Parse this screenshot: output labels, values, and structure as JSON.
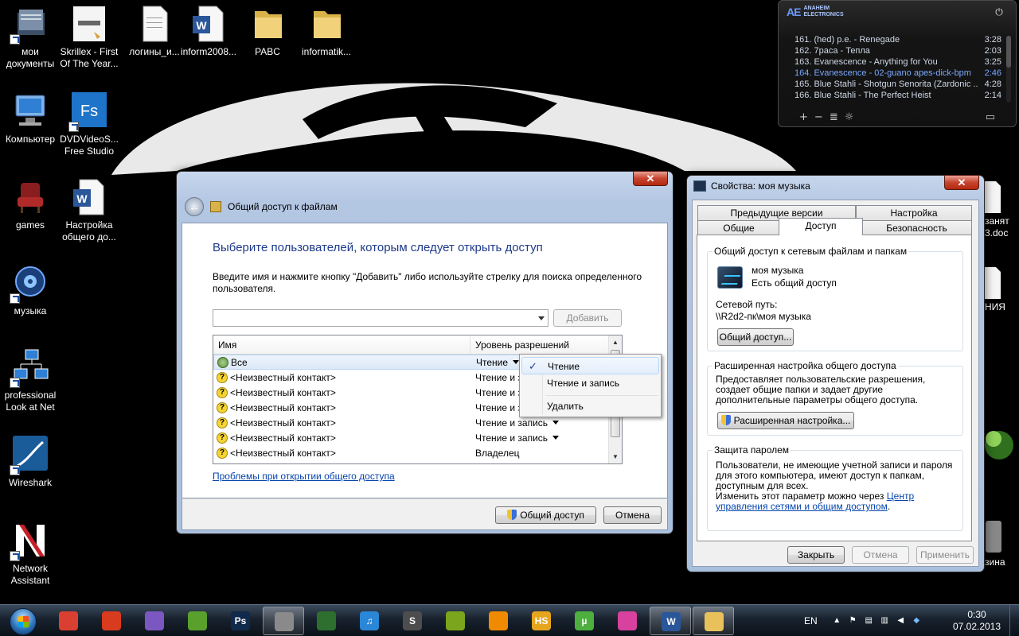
{
  "desktop": {
    "icons": [
      {
        "label": "мои документы",
        "icon": "documents-folder-icon"
      },
      {
        "label": "Skrillex - First Of The Year...",
        "icon": "image-file-icon"
      },
      {
        "label": "логины_и...",
        "icon": "text-file-icon"
      },
      {
        "label": "inform2008...",
        "icon": "word-doc-icon"
      },
      {
        "label": "PABC",
        "icon": "folder-icon"
      },
      {
        "label": "informatik...",
        "icon": "folder-icon"
      },
      {
        "label": "Компьютер",
        "icon": "computer-icon"
      },
      {
        "label": "DVDVideoS... Free Studio",
        "icon": "fs-app-icon"
      },
      {
        "label": "games",
        "icon": "armchair-icon"
      },
      {
        "label": "Настройка общего до...",
        "icon": "word-doc-icon"
      },
      {
        "label": "музыка",
        "icon": "music-icon"
      },
      {
        "label": "professional Look at Net",
        "icon": "network-icon"
      },
      {
        "label": "Wireshark",
        "icon": "wireshark-icon"
      },
      {
        "label": "Network Assistant",
        "icon": "network-assistant-icon"
      }
    ],
    "right_edge_labels": [
      "занят",
      "3.doc",
      "НИЯ",
      "зина"
    ]
  },
  "player": {
    "brand_line1": "ANAHEIM",
    "brand_line2": "ELECTRONICS",
    "brand_mark": "AE",
    "power_icon": "power-icon",
    "playlist": [
      {
        "title": "161. (hed) p.e. - Renegade",
        "duration": "3:28",
        "active": false
      },
      {
        "title": "162. 7раса - Тепла",
        "duration": "2:03",
        "active": false
      },
      {
        "title": "163. Evanescence - Anything for You",
        "duration": "3:25",
        "active": false
      },
      {
        "title": "164. Evanescence - 02-guano apes-dick-bpm",
        "duration": "2:46",
        "active": true
      },
      {
        "title": "165. Blue Stahli - Shotgun Senorita (Zardonic ...",
        "duration": "4:28",
        "active": false
      },
      {
        "title": "166. Blue Stahli - The Perfect Heist",
        "duration": "2:14",
        "active": false
      }
    ],
    "controls": [
      "+",
      "−",
      "≣",
      "☼"
    ]
  },
  "share_wizard": {
    "back_icon": "back-arrow-icon",
    "title": "Общий доступ к файлам",
    "heading": "Выберите пользователей, которым следует открыть доступ",
    "description": "Введите имя и нажмите кнопку \"Добавить\" либо используйте стрелку для поиска определенного пользователя.",
    "input_value": "",
    "add_button": "Добавить",
    "columns": [
      "Имя",
      "Уровень разрешений"
    ],
    "rows": [
      {
        "name": "Все",
        "permission": "Чтение",
        "icon": "users-group-icon",
        "selected": true,
        "dropdown": true
      },
      {
        "name": "<Неизвестный контакт>",
        "permission": "Чтение и запись",
        "icon": "unknown-contact-icon",
        "selected": false,
        "dropdown": true
      },
      {
        "name": "<Неизвестный контакт>",
        "permission": "Чтение и запись",
        "icon": "unknown-contact-icon",
        "selected": false,
        "dropdown": true
      },
      {
        "name": "<Неизвестный контакт>",
        "permission": "Чтение и запись",
        "icon": "unknown-contact-icon",
        "selected": false,
        "dropdown": true
      },
      {
        "name": "<Неизвестный контакт>",
        "permission": "Чтение и запись",
        "icon": "unknown-contact-icon",
        "selected": false,
        "dropdown": true
      },
      {
        "name": "<Неизвестный контакт>",
        "permission": "Чтение и запись",
        "icon": "unknown-contact-icon",
        "selected": false,
        "dropdown": true
      },
      {
        "name": "<Неизвестный контакт>",
        "permission": "Владелец",
        "icon": "unknown-contact-icon",
        "selected": false,
        "dropdown": false
      }
    ],
    "help_link": "Проблемы при открытии общего доступа",
    "share_button": "Общий доступ",
    "cancel_button": "Отмена"
  },
  "permission_menu": {
    "items": [
      "Чтение",
      "Чтение и запись",
      "Удалить"
    ],
    "checked": "Чтение",
    "check_mark": "✓"
  },
  "properties": {
    "title": "Свойства: моя музыка",
    "tabs_row1": [
      "Предыдущие версии",
      "Настройка"
    ],
    "tabs_row2": [
      "Общие",
      "Доступ",
      "Безопасность"
    ],
    "active_tab": "Доступ",
    "network_group": {
      "title": "Общий доступ к сетевым файлам и папкам",
      "folder_name": "моя музыка",
      "status": "Есть общий доступ",
      "path_label": "Сетевой путь:",
      "path": "\\\\R2d2-пк\\моя музыка",
      "button": "Общий доступ..."
    },
    "advanced_group": {
      "title": "Расширенная настройка общего доступа",
      "text": "Предоставляет пользовательские разрешения, создает общие папки и задает другие дополнительные параметры общего доступа.",
      "button": "Расширенная настройка..."
    },
    "password_group": {
      "title": "Защита паролем",
      "text": "Пользователи, не имеющие учетной записи и пароля для этого компьютера, имеют доступ к папкам, доступным для всех.",
      "change_prefix": "Изменить этот параметр можно через ",
      "change_link": "Центр управления сетями и общим доступом",
      "change_suffix": "."
    },
    "buttons": {
      "close": "Закрыть",
      "cancel": "Отмена",
      "apply": "Применить"
    }
  },
  "taskbar": {
    "apps": [
      {
        "name": "chrome-icon",
        "glyph": "",
        "color": "#d94032",
        "active": false
      },
      {
        "name": "lightning-app-icon",
        "glyph": "",
        "color": "#d83b1e",
        "active": false
      },
      {
        "name": "visual-studio-icon",
        "glyph": "",
        "color": "#7b57c1",
        "active": false
      },
      {
        "name": "geo-app-icon",
        "glyph": "",
        "color": "#5aa02c",
        "active": false
      },
      {
        "name": "photoshop-icon",
        "glyph": "Ps",
        "color": "#0f2a4a",
        "active": false
      },
      {
        "name": "aimp-icon",
        "glyph": "",
        "color": "#8a8a8a",
        "active": true
      },
      {
        "name": "cd-player-icon",
        "glyph": "",
        "color": "#2e6e2e",
        "active": false
      },
      {
        "name": "music-notes-icon",
        "glyph": "♫",
        "color": "#2a86d6",
        "active": false
      },
      {
        "name": "sublime-icon",
        "glyph": "S",
        "color": "#4d4d4d",
        "active": false
      },
      {
        "name": "puzzle-app-icon",
        "glyph": "",
        "color": "#7aa51c",
        "active": false
      },
      {
        "name": "vlc-icon",
        "glyph": "",
        "color": "#f08a00",
        "active": false
      },
      {
        "name": "hs-app-icon",
        "glyph": "HS",
        "color": "#e7a51e",
        "active": false
      },
      {
        "name": "utorrent-icon",
        "glyph": "µ",
        "color": "#4caf3e",
        "active": false
      },
      {
        "name": "media-app-icon",
        "glyph": "",
        "color": "#d8419d",
        "active": false
      },
      {
        "name": "word-icon",
        "glyph": "W",
        "color": "#2b579a",
        "active": true
      },
      {
        "name": "explorer-icon",
        "glyph": "",
        "color": "#e8c15a",
        "active": true
      }
    ],
    "language": "EN",
    "tray_icons": [
      "show-hidden-icon",
      "flag-icon",
      "printer-icon",
      "network-icon",
      "speaker-icon",
      "dropbox-icon"
    ],
    "time": "0:30",
    "date": "07.02.2013"
  }
}
